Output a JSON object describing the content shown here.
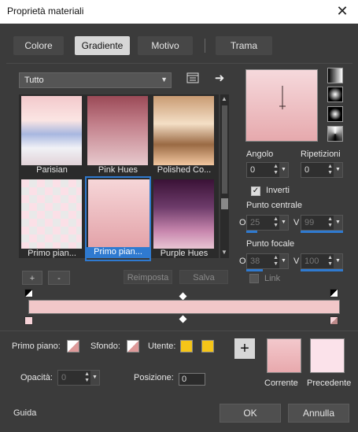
{
  "window": {
    "title": "Proprietà materiali",
    "close_glyph": "✕"
  },
  "tabs": [
    "Colore",
    "Gradiente",
    "Motivo",
    "Trama"
  ],
  "active_tab": "Gradiente",
  "category": {
    "value": "Tutto"
  },
  "gradients": [
    {
      "label": "Parisian"
    },
    {
      "label": "Pink Hues"
    },
    {
      "label": "Polished Co..."
    },
    {
      "label": "Primo pian..."
    },
    {
      "label": "Primo pian..."
    },
    {
      "label": "Purple Hues"
    }
  ],
  "gallery_buttons": {
    "add": "+",
    "remove": "-",
    "reset": "Reimposta",
    "save": "Salva"
  },
  "angle": {
    "label": "Angolo",
    "value": "0"
  },
  "repeats": {
    "label": "Ripetizioni",
    "value": "0"
  },
  "invert": {
    "label": "Inverti",
    "checked": true
  },
  "center_point": {
    "label": "Punto centrale",
    "o_label": "O",
    "o_value": "25",
    "v_label": "V",
    "v_value": "99"
  },
  "focal_point": {
    "label": "Punto focale",
    "o_label": "O",
    "o_value": "38",
    "v_label": "V",
    "v_value": "100"
  },
  "link": {
    "label": "Link",
    "checked": false
  },
  "bottom": {
    "foreground_label": "Primo piano:",
    "background_label": "Sfondo:",
    "user_label": "Utente:",
    "opacity_label": "Opacità:",
    "opacity_value": "0",
    "position_label": "Posizione:",
    "position_value": "0",
    "current_label": "Corrente",
    "previous_label": "Precedente",
    "user_color": "#f5c518",
    "current_color": "#e8a9ad",
    "previous_color": "#fbe2ea"
  },
  "footer": {
    "help": "Guida",
    "ok": "OK",
    "cancel": "Annulla"
  }
}
